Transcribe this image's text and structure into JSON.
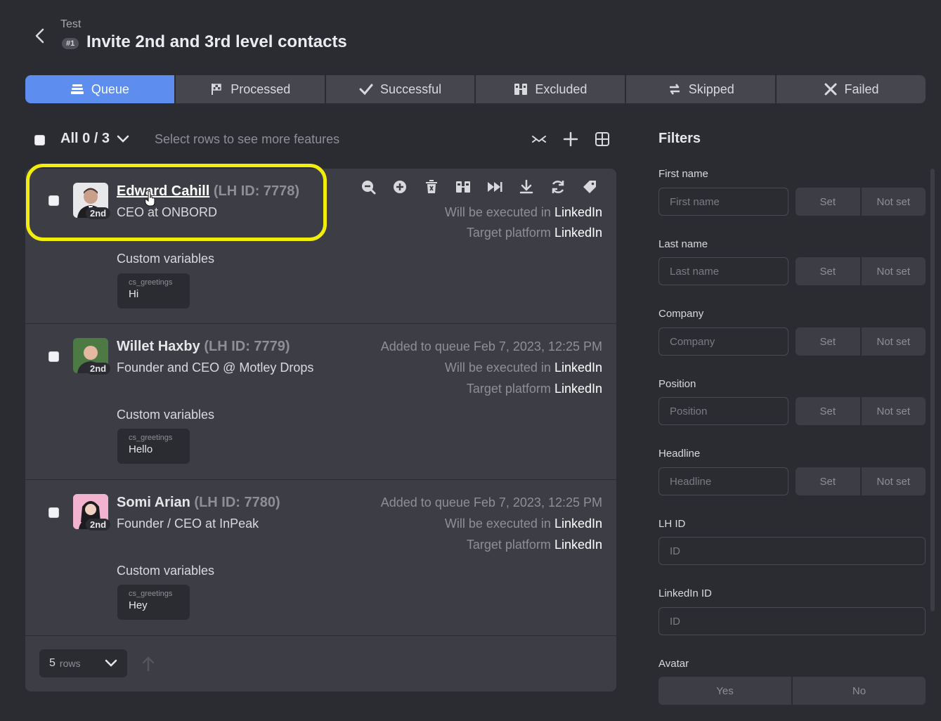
{
  "header": {
    "crumb": "Test",
    "badge": "#1",
    "title": "Invite 2nd and 3rd level contacts"
  },
  "tabs": [
    {
      "label": "Queue",
      "icon": "queue-icon",
      "active": true
    },
    {
      "label": "Processed",
      "icon": "flag-icon",
      "active": false
    },
    {
      "label": "Successful",
      "icon": "check-icon",
      "active": false
    },
    {
      "label": "Excluded",
      "icon": "excluded-icon",
      "active": false
    },
    {
      "label": "Skipped",
      "icon": "skip-icon",
      "active": false
    },
    {
      "label": "Failed",
      "icon": "x-icon",
      "active": false
    }
  ],
  "toolbar": {
    "selection": "All 0 / 3",
    "hint": "Select rows to see more features"
  },
  "rows": [
    {
      "name": "Edward Cahill",
      "lh_id": "(LH ID: 7778)",
      "headline": "CEO at ONBORD",
      "degree": "2nd",
      "added": "",
      "executed_prefix": "Will be executed in",
      "executed_platform": "LinkedIn",
      "target_prefix": "Target platform",
      "target_platform": "LinkedIn",
      "cv_label": "Custom variables",
      "cv_key": "cs_greetings",
      "cv_value": "Hi"
    },
    {
      "name": "Willet Haxby",
      "lh_id": "(LH ID: 7779)",
      "headline": "Founder and CEO @ Motley Drops",
      "degree": "2nd",
      "added": "Added to queue Feb 7, 2023, 12:25 PM",
      "executed_prefix": "Will be executed in",
      "executed_platform": "LinkedIn",
      "target_prefix": "Target platform",
      "target_platform": "LinkedIn",
      "cv_label": "Custom variables",
      "cv_key": "cs_greetings",
      "cv_value": "Hello"
    },
    {
      "name": "Somi Arian",
      "lh_id": "(LH ID: 7780)",
      "headline": "Founder / CEO at InPeak",
      "degree": "2nd",
      "added": "Added to queue Feb 7, 2023, 12:25 PM",
      "executed_prefix": "Will be executed in",
      "executed_platform": "LinkedIn",
      "target_prefix": "Target platform",
      "target_platform": "LinkedIn",
      "cv_label": "Custom variables",
      "cv_key": "cs_greetings",
      "cv_value": "Hey"
    }
  ],
  "pagination": {
    "rows_count": "5",
    "rows_label": "rows"
  },
  "filters": {
    "title": "Filters",
    "set_label": "Set",
    "not_set_label": "Not set",
    "first_name": {
      "label": "First name",
      "placeholder": "First name"
    },
    "last_name": {
      "label": "Last name",
      "placeholder": "Last name"
    },
    "company": {
      "label": "Company",
      "placeholder": "Company"
    },
    "position": {
      "label": "Position",
      "placeholder": "Position"
    },
    "headline": {
      "label": "Headline",
      "placeholder": "Headline"
    },
    "lh_id": {
      "label": "LH ID",
      "placeholder": "ID"
    },
    "linkedin_id": {
      "label": "LinkedIn ID",
      "placeholder": "ID"
    },
    "avatar": {
      "label": "Avatar",
      "yes": "Yes",
      "no": "No"
    }
  },
  "colors": {
    "accent": "#5e8df0",
    "highlight": "#f2ee0b",
    "background": "#2b2c31",
    "panel": "#3d3e45"
  }
}
